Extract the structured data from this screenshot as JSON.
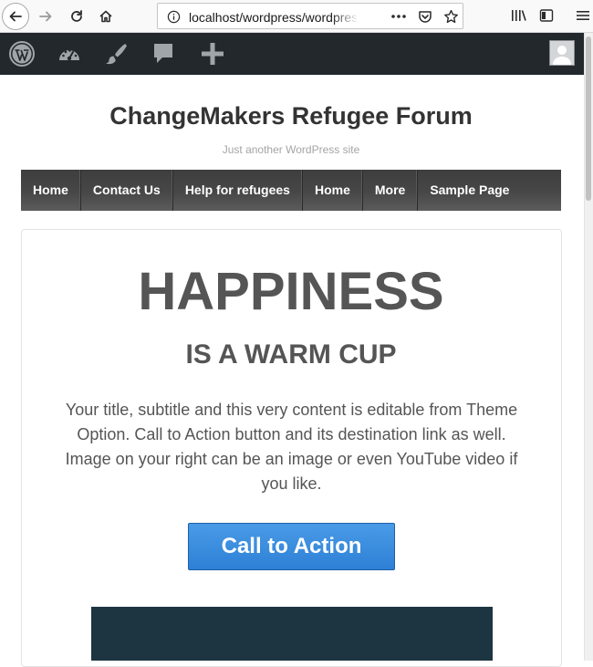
{
  "browser": {
    "url": "localhost/wordpress/wordpress/"
  },
  "admin_bar": {
    "icons": [
      "wordpress-logo-icon",
      "dashboard-icon",
      "customize-brush-icon",
      "comments-icon",
      "new-plus-icon",
      "user-avatar"
    ]
  },
  "site": {
    "title": "ChangeMakers Refugee Forum",
    "tagline": "Just another WordPress site"
  },
  "nav": {
    "items": [
      {
        "label": "Home"
      },
      {
        "label": "Contact Us"
      },
      {
        "label": "Help for refugees"
      },
      {
        "label": "Home"
      },
      {
        "label": "More"
      },
      {
        "label": "Sample Page"
      }
    ]
  },
  "hero": {
    "title": "HAPPINESS",
    "subtitle": "IS A WARM CUP",
    "body": "Your title, subtitle and this very content is editable from Theme Option. Call to Action button and its destination link as well. Image on your right can be an image or even YouTube video if you like.",
    "cta_label": "Call to Action"
  },
  "colors": {
    "admin_bar": "#23282d",
    "nav_background": "#474747",
    "cta_blue": "#2d80d6",
    "text_dark": "#555555",
    "media_block": "#1c3540"
  }
}
